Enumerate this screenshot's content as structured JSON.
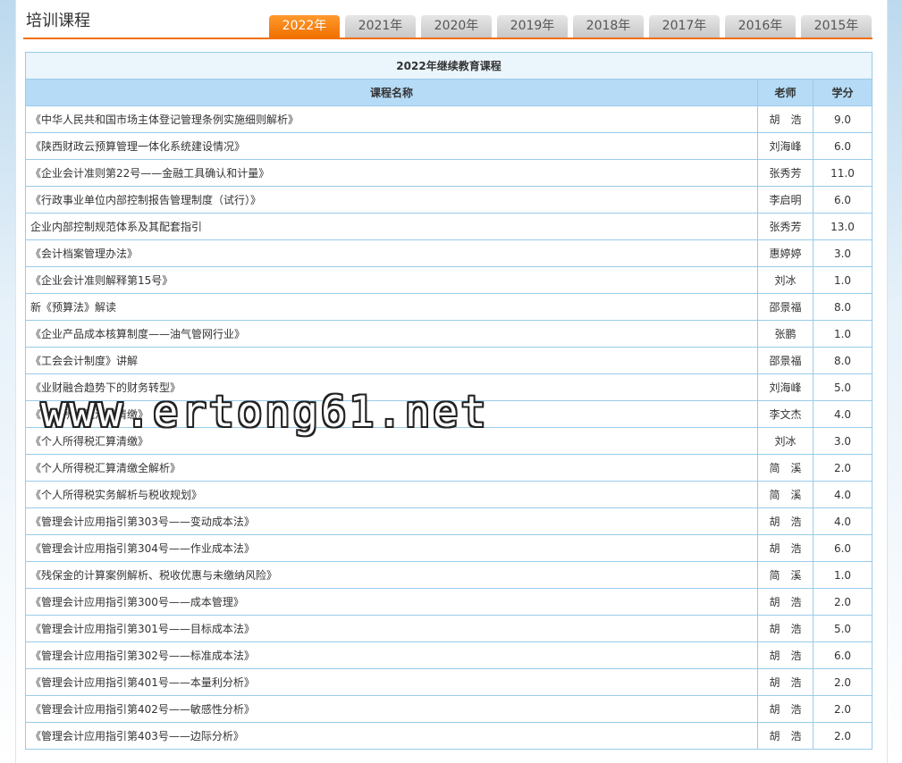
{
  "page": {
    "title": "培训课程",
    "watermark": "www.ertong61.net"
  },
  "tabs": [
    {
      "label": "2022年",
      "active": true
    },
    {
      "label": "2021年",
      "active": false
    },
    {
      "label": "2020年",
      "active": false
    },
    {
      "label": "2019年",
      "active": false
    },
    {
      "label": "2018年",
      "active": false
    },
    {
      "label": "2017年",
      "active": false
    },
    {
      "label": "2016年",
      "active": false
    },
    {
      "label": "2015年",
      "active": false
    }
  ],
  "table": {
    "caption": "2022年继续教育课程",
    "headers": {
      "name": "课程名称",
      "teacher": "老师",
      "credit": "学分"
    },
    "rows": [
      {
        "name": "《中华人民共和国市场主体登记管理条例实施细则解析》",
        "teacher": "胡　浩",
        "credit": "9.0"
      },
      {
        "name": "《陕西财政云预算管理一体化系统建设情况》",
        "teacher": "刘海峰",
        "credit": "6.0"
      },
      {
        "name": "《企业会计准则第22号——金融工具确认和计量》",
        "teacher": "张秀芳",
        "credit": "11.0"
      },
      {
        "name": "《行政事业单位内部控制报告管理制度（试行）》",
        "teacher": "李启明",
        "credit": "6.0"
      },
      {
        "name": "企业内部控制规范体系及其配套指引",
        "teacher": "张秀芳",
        "credit": "13.0"
      },
      {
        "name": "《会计档案管理办法》",
        "teacher": "惠婷婷",
        "credit": "3.0"
      },
      {
        "name": "《企业会计准则解释第15号》",
        "teacher": "刘冰",
        "credit": "1.0"
      },
      {
        "name": "新《预算法》解读",
        "teacher": "邵景福",
        "credit": "8.0"
      },
      {
        "name": "《企业产品成本核算制度——油气管网行业》",
        "teacher": "张鹏",
        "credit": "1.0"
      },
      {
        "name": "《工会会计制度》讲解",
        "teacher": "邵景福",
        "credit": "8.0"
      },
      {
        "name": "《业财融合趋势下的财务转型》",
        "teacher": "刘海峰",
        "credit": "5.0"
      },
      {
        "name": "《个人所得税汇算清缴》",
        "teacher": "李文杰",
        "credit": "4.0"
      },
      {
        "name": "《个人所得税汇算清缴》",
        "teacher": "刘冰",
        "credit": "3.0"
      },
      {
        "name": "《个人所得税汇算清缴全解析》",
        "teacher": "简　溪",
        "credit": "2.0"
      },
      {
        "name": "《个人所得税实务解析与税收规划》",
        "teacher": "简　溪",
        "credit": "4.0"
      },
      {
        "name": "《管理会计应用指引第303号——变动成本法》",
        "teacher": "胡　浩",
        "credit": "4.0"
      },
      {
        "name": "《管理会计应用指引第304号——作业成本法》",
        "teacher": "胡　浩",
        "credit": "6.0"
      },
      {
        "name": "《残保金的计算案例解析、税收优惠与未缴纳风险》",
        "teacher": "简　溪",
        "credit": "1.0"
      },
      {
        "name": "《管理会计应用指引第300号——成本管理》",
        "teacher": "胡　浩",
        "credit": "2.0"
      },
      {
        "name": "《管理会计应用指引第301号——目标成本法》",
        "teacher": "胡　浩",
        "credit": "5.0"
      },
      {
        "name": "《管理会计应用指引第302号——标准成本法》",
        "teacher": "胡　浩",
        "credit": "6.0"
      },
      {
        "name": "《管理会计应用指引第401号——本量利分析》",
        "teacher": "胡　浩",
        "credit": "2.0"
      },
      {
        "name": "《管理会计应用指引第402号——敏感性分析》",
        "teacher": "胡　浩",
        "credit": "2.0"
      },
      {
        "name": "《管理会计应用指引第403号——边际分析》",
        "teacher": "胡　浩",
        "credit": "2.0"
      }
    ]
  }
}
